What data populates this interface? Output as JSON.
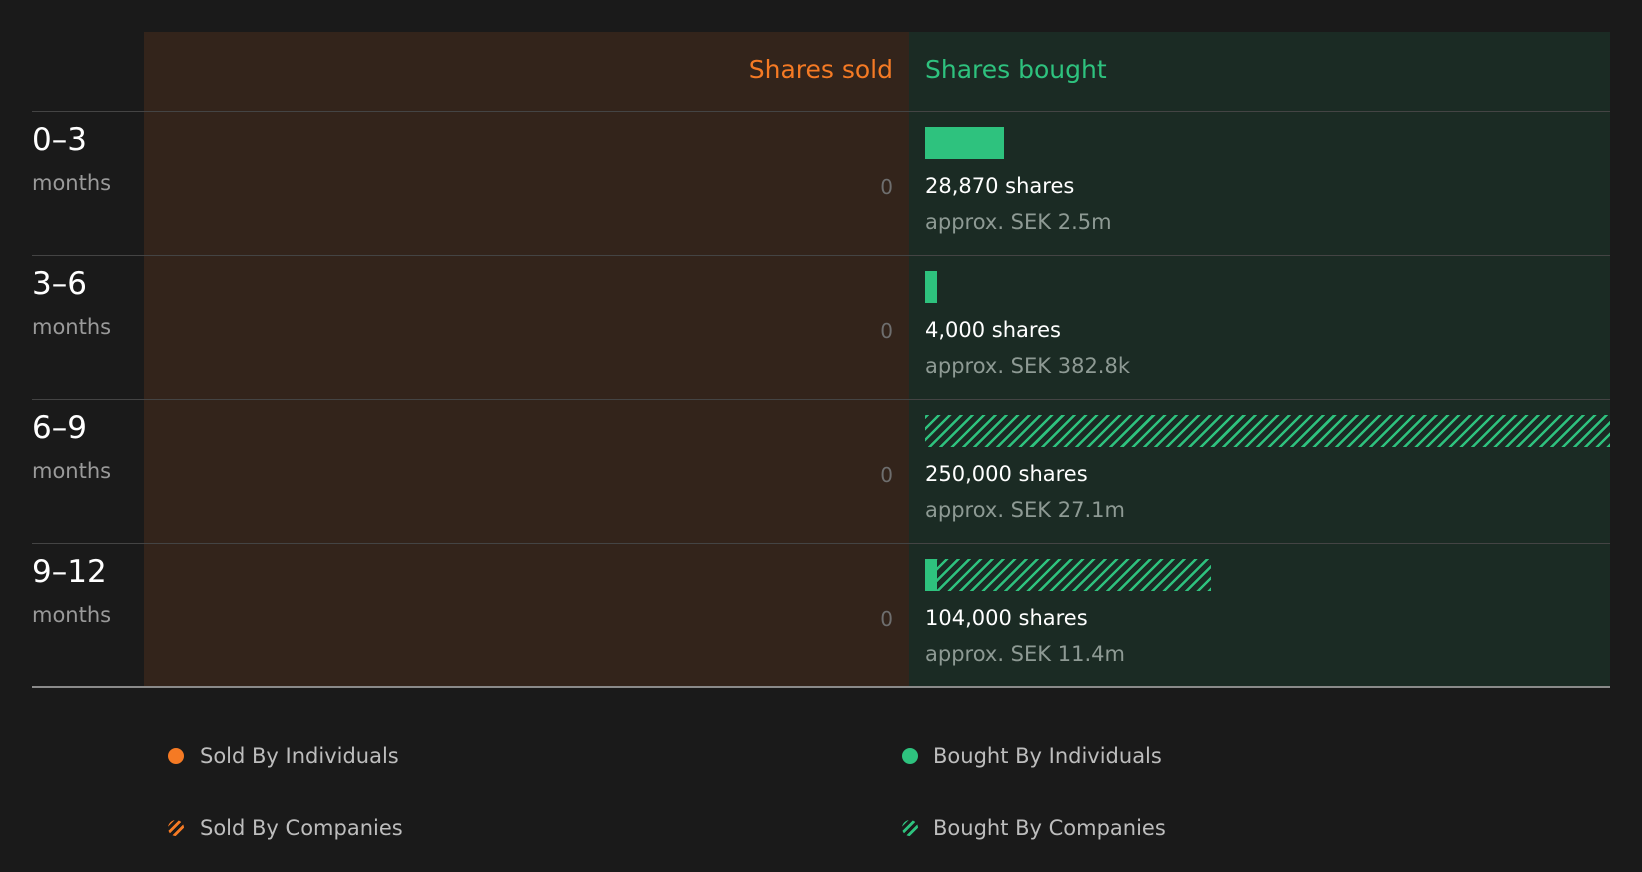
{
  "chart_data": {
    "type": "bar",
    "headers": {
      "sold": "Shares sold",
      "bought": "Shares bought"
    },
    "max_value": 250000,
    "rows": [
      {
        "period": "0–3",
        "unit": "months",
        "sold_label": "0",
        "sold_individuals": 0,
        "sold_companies": 0,
        "bought_individuals": 28870,
        "bought_companies": 0,
        "shares_label": "28,870 shares",
        "value_label": "approx. SEK 2.5m"
      },
      {
        "period": "3–6",
        "unit": "months",
        "sold_label": "0",
        "sold_individuals": 0,
        "sold_companies": 0,
        "bought_individuals": 4000,
        "bought_companies": 0,
        "shares_label": "4,000 shares",
        "value_label": "approx. SEK 382.8k"
      },
      {
        "period": "6–9",
        "unit": "months",
        "sold_label": "0",
        "sold_individuals": 0,
        "sold_companies": 0,
        "bought_individuals": 0,
        "bought_companies": 250000,
        "shares_label": "250,000 shares",
        "value_label": "approx. SEK 27.1m"
      },
      {
        "period": "9–12",
        "unit": "months",
        "sold_label": "0",
        "sold_individuals": 0,
        "sold_companies": 0,
        "bought_individuals": 4000,
        "bought_companies": 100000,
        "shares_label": "104,000 shares",
        "value_label": "approx. SEK 11.4m"
      }
    ],
    "legend": {
      "sold_individuals": "Sold By Individuals",
      "bought_individuals": "Bought By Individuals",
      "sold_companies": "Sold By Companies",
      "bought_companies": "Bought By Companies"
    },
    "colors": {
      "sold": "#f57a24",
      "bought": "#2ec27e",
      "sold_panel": "#33241b",
      "bought_panel": "#1b2b24",
      "background": "#1a1a1a"
    }
  }
}
